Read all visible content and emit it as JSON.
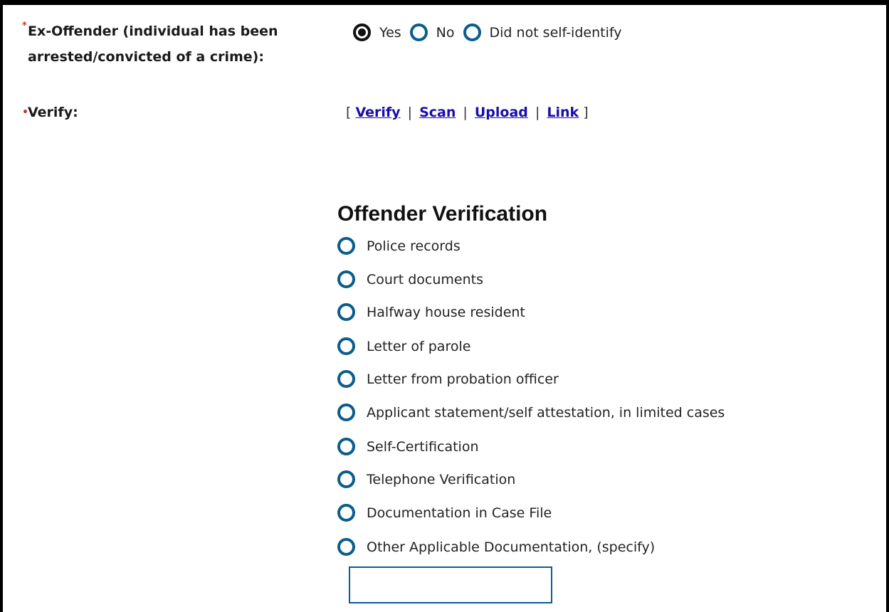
{
  "ex_offender": {
    "required_mark": "*",
    "label_line1": "Ex-Offender (individual has been",
    "label_line2": "arrested/convicted of a crime):",
    "options": [
      {
        "label": "Yes",
        "selected": true
      },
      {
        "label": "No",
        "selected": false
      },
      {
        "label": "Did not self-identify",
        "selected": false
      }
    ]
  },
  "verify": {
    "required_mark": "•",
    "label": "Verify:",
    "open_bracket": "[",
    "close_bracket": "]",
    "separator": "|",
    "links": [
      "Verify",
      "Scan",
      "Upload",
      "Link"
    ]
  },
  "offender_verification": {
    "title": "Offender Verification",
    "options": [
      "Police records",
      "Court documents",
      "Halfway house resident",
      "Letter of parole",
      "Letter from probation officer",
      "Applicant statement/self attestation, in limited cases",
      "Self-Certification",
      "Telephone Verification",
      "Documentation in Case File",
      "Other Applicable Documentation, (specify)"
    ],
    "specify_value": ""
  },
  "colors": {
    "radio_border": "#0b5d8c",
    "link": "#1a0dab",
    "required": "#c0392b"
  }
}
